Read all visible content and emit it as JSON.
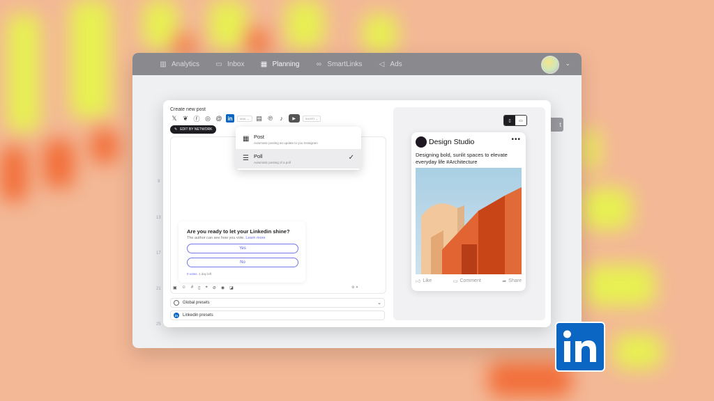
{
  "nav": {
    "items": [
      {
        "label": "Analytics",
        "icon": "bar-chart-icon"
      },
      {
        "label": "Inbox",
        "icon": "inbox-icon"
      },
      {
        "label": "Planning",
        "icon": "calendar-icon",
        "active": true
      },
      {
        "label": "SmartLinks",
        "icon": "link-icon"
      },
      {
        "label": "Ads",
        "icon": "megaphone-icon"
      }
    ]
  },
  "background": {
    "row_numbers": [
      "9",
      "13",
      "17",
      "21",
      "25"
    ],
    "button_label": "t"
  },
  "modal": {
    "title": "Create new post",
    "network_select_1": "MAIL",
    "network_select_2": "SHORT",
    "edit_by_network": "EDIT BY NETWORK",
    "poll": {
      "question": "Are you ready to let your Linkedin shine?",
      "subtitle": "The author can see how you vote.",
      "learn_more": "Learn more",
      "option_yes": "Yes",
      "option_no": "No",
      "votes": "0 votes.",
      "time_left": "1 day left"
    },
    "presets": {
      "global": "Global presets",
      "linkedin": "Linkedin presets"
    }
  },
  "dropdown": {
    "items": [
      {
        "title": "Post",
        "description": "Automatic posting an update to you Instagram",
        "icon": "grid-icon"
      },
      {
        "title": "Poll",
        "description": "Automatic posting of a poll",
        "icon": "list-icon",
        "selected": true
      }
    ]
  },
  "preview": {
    "author": "Design Studio",
    "text": "Designing bold, sunlit spaces to elevate everyday life #Architecture",
    "actions": {
      "like": "Like",
      "comment": "Comment",
      "share": "Share"
    }
  },
  "colors": {
    "linkedin_blue": "#0a66c2",
    "poll_accent": "#6b6ff0",
    "background": "#f3b896"
  }
}
